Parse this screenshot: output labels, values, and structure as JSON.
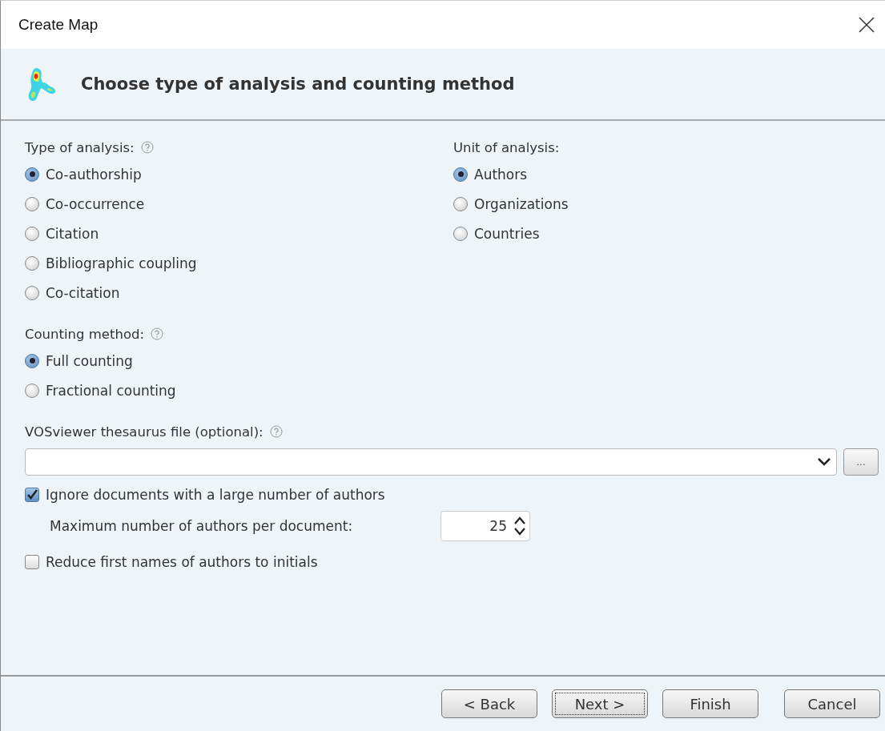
{
  "window": {
    "title": "Create Map"
  },
  "header": {
    "title": "Choose type of analysis and counting method"
  },
  "analysis_type": {
    "label": "Type of analysis:",
    "options": [
      {
        "label": "Co-authorship",
        "selected": true
      },
      {
        "label": "Co-occurrence",
        "selected": false
      },
      {
        "label": "Citation",
        "selected": false
      },
      {
        "label": "Bibliographic coupling",
        "selected": false
      },
      {
        "label": "Co-citation",
        "selected": false
      }
    ]
  },
  "unit_of_analysis": {
    "label": "Unit of analysis:",
    "options": [
      {
        "label": "Authors",
        "selected": true
      },
      {
        "label": "Organizations",
        "selected": false
      },
      {
        "label": "Countries",
        "selected": false
      }
    ]
  },
  "counting_method": {
    "label": "Counting method:",
    "options": [
      {
        "label": "Full counting",
        "selected": true
      },
      {
        "label": "Fractional counting",
        "selected": false
      }
    ]
  },
  "thesaurus": {
    "label": "VOSviewer thesaurus file (optional):",
    "browse": "..."
  },
  "ignore_documents": {
    "label": "Ignore documents with a large number of authors",
    "checked": true
  },
  "max_authors": {
    "label": "Maximum number of authors per document:",
    "value": "25"
  },
  "reduce_names": {
    "label": "Reduce first names of authors to initials",
    "checked": false
  },
  "buttons": [
    {
      "label": "< Back",
      "focused": false
    },
    {
      "label": "Next >",
      "focused": true
    },
    {
      "label": "Finish",
      "focused": false
    },
    {
      "label": "Cancel",
      "focused": false
    }
  ]
}
